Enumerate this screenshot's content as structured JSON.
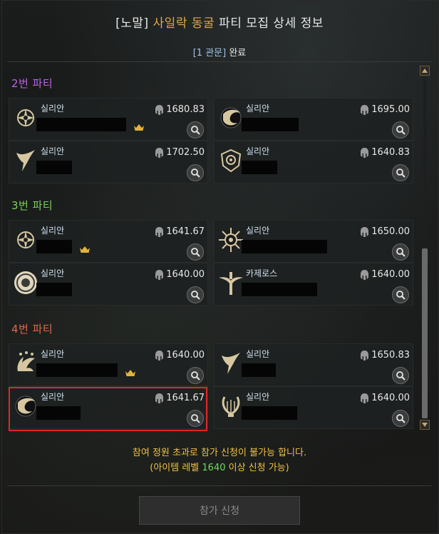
{
  "header": {
    "title_prefix": "[노말] ",
    "title_accent": "사일락 동굴",
    "title_suffix": " 파티 모집 상세 정보",
    "progress_link": "[1 관문]",
    "progress_status": " 완료"
  },
  "parties": [
    {
      "label": "2번 파티",
      "color": "#b866e0",
      "members": [
        {
          "class": "실리안",
          "item_level": "1680.83",
          "icon": "ring-star-emblem-icon",
          "crown": true
        },
        {
          "class": "실리안",
          "item_level": "1695.00",
          "icon": "wing-swirl-emblem-icon",
          "crown": false
        },
        {
          "class": "실리안",
          "item_level": "1702.50",
          "icon": "wing-blade-emblem-icon",
          "crown": false
        },
        {
          "class": "실리안",
          "item_level": "1640.83",
          "icon": "spiral-shield-emblem-icon",
          "crown": false
        }
      ]
    },
    {
      "label": "3번 파티",
      "color": "#7fcf5a",
      "members": [
        {
          "class": "실리안",
          "item_level": "1641.67",
          "icon": "ring-star-emblem-icon",
          "crown": true
        },
        {
          "class": "실리안",
          "item_level": "1650.00",
          "icon": "sun-emblem-icon",
          "crown": false
        },
        {
          "class": "실리안",
          "item_level": "1640.00",
          "icon": "round-seal-emblem-icon",
          "crown": false
        },
        {
          "class": "카제로스",
          "item_level": "1640.00",
          "icon": "sword-wing-emblem-icon",
          "crown": false
        }
      ]
    },
    {
      "label": "4번 파티",
      "color": "#e06a4a",
      "members": [
        {
          "class": "실리안",
          "item_level": "1640.00",
          "icon": "claw-emblem-icon",
          "crown": true
        },
        {
          "class": "실리안",
          "item_level": "1650.83",
          "icon": "wing-blade-emblem-icon",
          "crown": false
        },
        {
          "class": "실리안",
          "item_level": "1641.67",
          "icon": "wing-swirl-emblem-icon",
          "crown": false
        },
        {
          "class": "실리안",
          "item_level": "1640.00",
          "icon": "lyre-emblem-icon",
          "crown": false
        }
      ]
    }
  ],
  "notice": {
    "line1": "참여 정원 초과로 참가 신청이 불가능 합니다.",
    "line2_prefix": "(아이템 레벨 ",
    "line2_level": "1640",
    "line2_suffix": " 이상 신청 가능)"
  },
  "apply_button": "참가 신청",
  "colors": {
    "accent": "#e3a74a",
    "notice": "#f0c040",
    "level_highlight": "#6fdc5a",
    "selection_border": "#e0262a"
  }
}
